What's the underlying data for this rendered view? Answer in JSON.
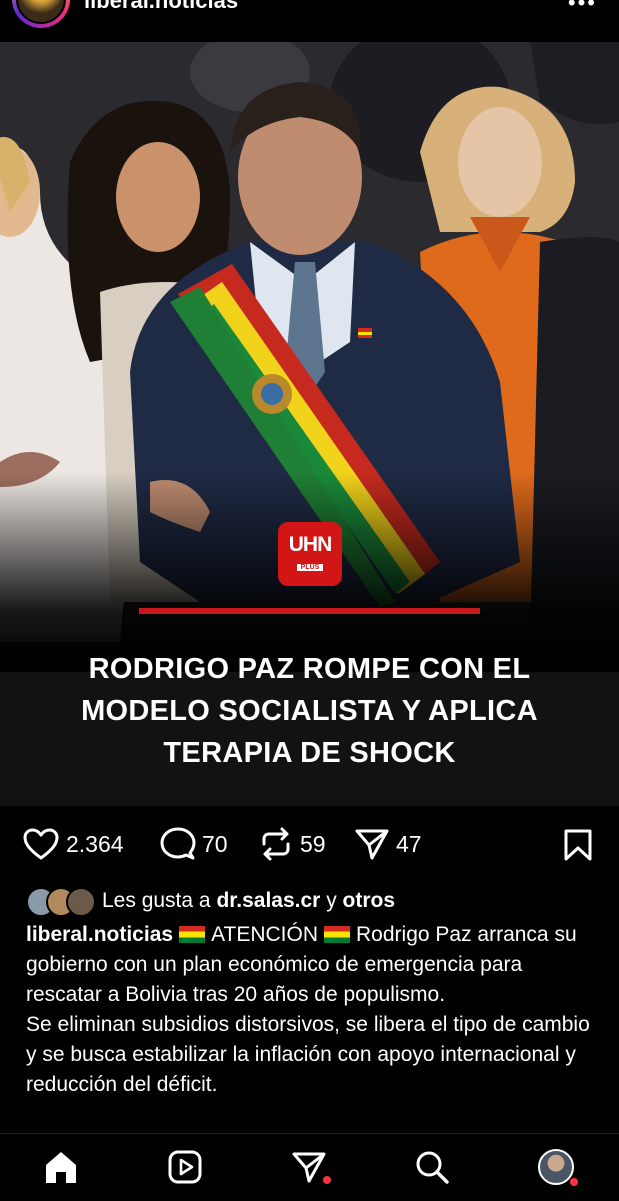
{
  "header": {
    "username": "liberal.noticias",
    "more_label": "•••"
  },
  "post": {
    "logo_text": "UHN",
    "logo_subtext": "PLUS",
    "headline": "RODRIGO PAZ ROMPE CON EL MODELO SOCIALISTA Y APLICA TERAPIA DE SHOCK"
  },
  "actions": {
    "likes_count": "2.364",
    "comments_count": "70",
    "reposts_count": "59",
    "shares_count": "47"
  },
  "likes_line": {
    "prefix": "Les gusta a",
    "user": "dr.salas.cr",
    "connector": "y",
    "others": "otros"
  },
  "caption": {
    "username": "liberal.noticias",
    "attention": "ATENCIÓN",
    "text1": "Rodrigo Paz arranca su gobierno con un plan económico de emergencia para rescatar a Bolivia tras 20 años de populismo.",
    "text2": "Se eliminan subsidios distorsivos, se libera el tipo de cambio y se busca estabilizar la inflación con apoyo internacional y reducción del déficit."
  },
  "bottom_nav": {
    "items": [
      "home-icon",
      "reels-icon",
      "send-icon",
      "search-icon",
      "profile-avatar"
    ]
  },
  "colors": {
    "accent_red": "#c91818",
    "notification_red": "#ff3040",
    "background": "#000000"
  }
}
